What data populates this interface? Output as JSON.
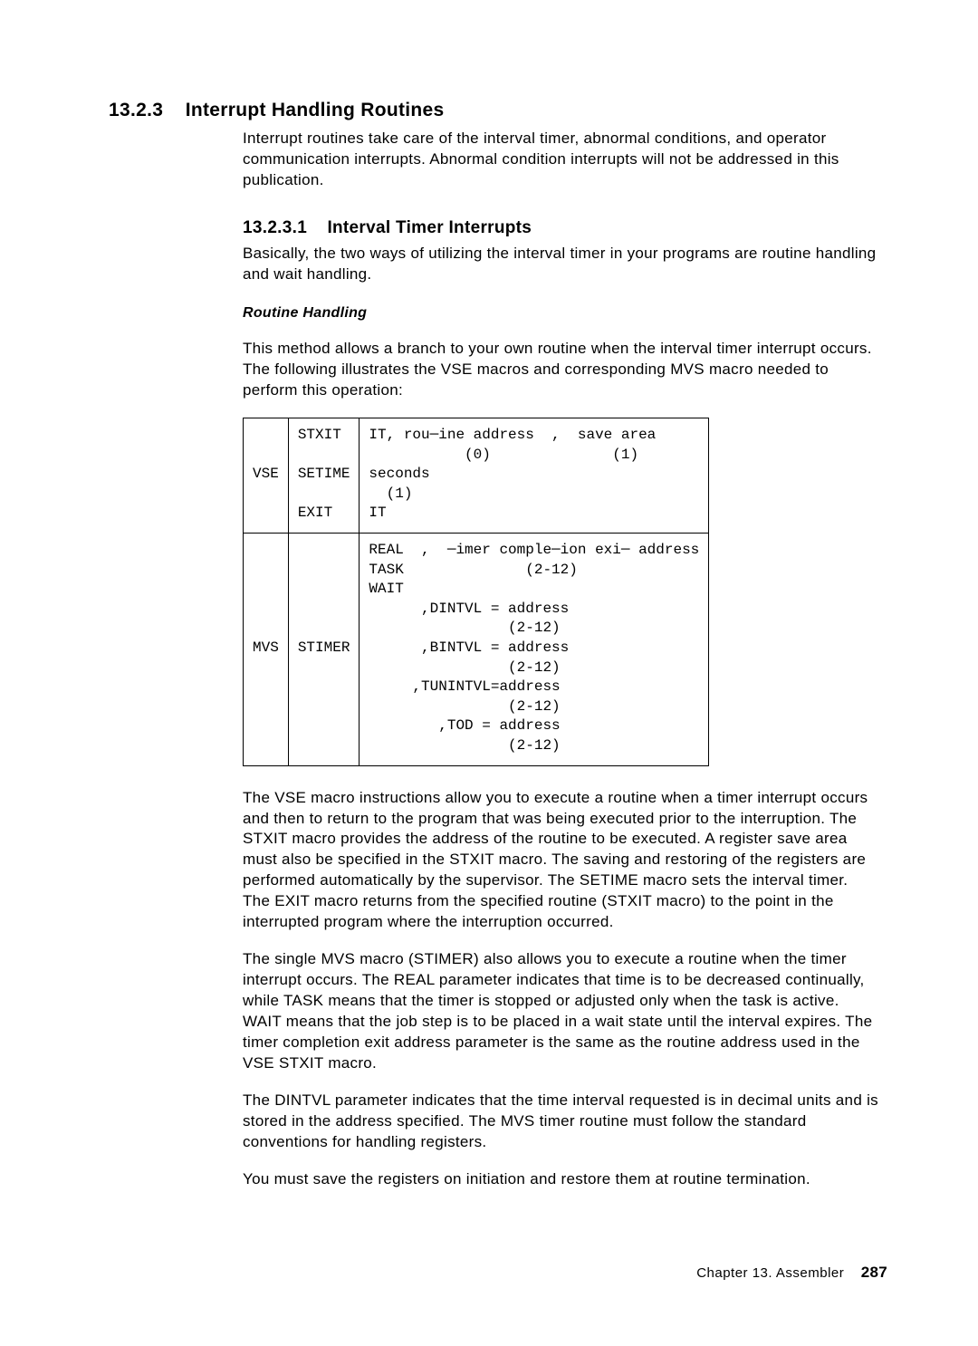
{
  "section": {
    "number": "13.2.3",
    "title": "Interrupt Handling Routines",
    "intro": "Interrupt routines take care of the interval timer, abnormal conditions, and operator communication interrupts. Abnormal condition interrupts will not be addressed in this publication."
  },
  "subsection": {
    "number": "13.2.3.1",
    "title": "Interval Timer Interrupts",
    "intro": "Basically, the two ways of utilizing the interval timer in your programs are routine handling and wait handling."
  },
  "routine": {
    "heading": "Routine Handling",
    "para1": "This method allows a branch to your own routine when the interval timer interrupt occurs. The following illustrates the VSE macros and corresponding MVS macro needed to perform this operation:"
  },
  "table": {
    "row1": {
      "c1": "VSE",
      "c2": "STXIT\n\nSETIME\n\nEXIT",
      "c3": "IT, rou─ine address  ,  save area\n           (0)              (1)\nseconds\n  (1)\nIT"
    },
    "row2": {
      "c1": "MVS",
      "c2": "STIMER",
      "c3": "REAL  ,  ─imer comple─ion exi─ address\nTASK              (2-12)\nWAIT\n      ,DINTVL = address\n                (2-12)\n      ,BINTVL = address\n                (2-12)\n     ,TUNINTVL=address\n                (2-12)\n        ,TOD = address\n                (2-12)"
    }
  },
  "after": {
    "p1": "The VSE macro instructions allow you to execute a routine when a timer interrupt occurs and then to return to the program that was being executed prior to the interruption. The STXIT macro provides the address of the routine to be executed. A register save area must also be specified in the STXIT macro. The saving and restoring of the registers are performed automatically by the supervisor. The SETIME macro sets the interval timer. The EXIT macro returns from the specified routine (STXIT macro) to the point in the interrupted program where the interruption occurred.",
    "p2": "The single MVS macro (STIMER) also allows you to execute a routine when the timer interrupt occurs. The REAL parameter indicates that time is to be decreased continually, while TASK means that the timer is stopped or adjusted only when the task is active. WAIT means that the job step is to be placed in a wait state until the interval expires. The timer completion exit address parameter is the same as the routine address used in the VSE STXIT macro.",
    "p3": "The DINTVL parameter indicates that the time interval requested is in decimal units and is stored in the address specified. The MVS timer routine must follow the standard conventions for handling registers.",
    "p4": "You must save the registers on initiation and restore them at routine termination."
  },
  "footer": {
    "chapter": "Chapter 13. Assembler",
    "page": "287"
  }
}
